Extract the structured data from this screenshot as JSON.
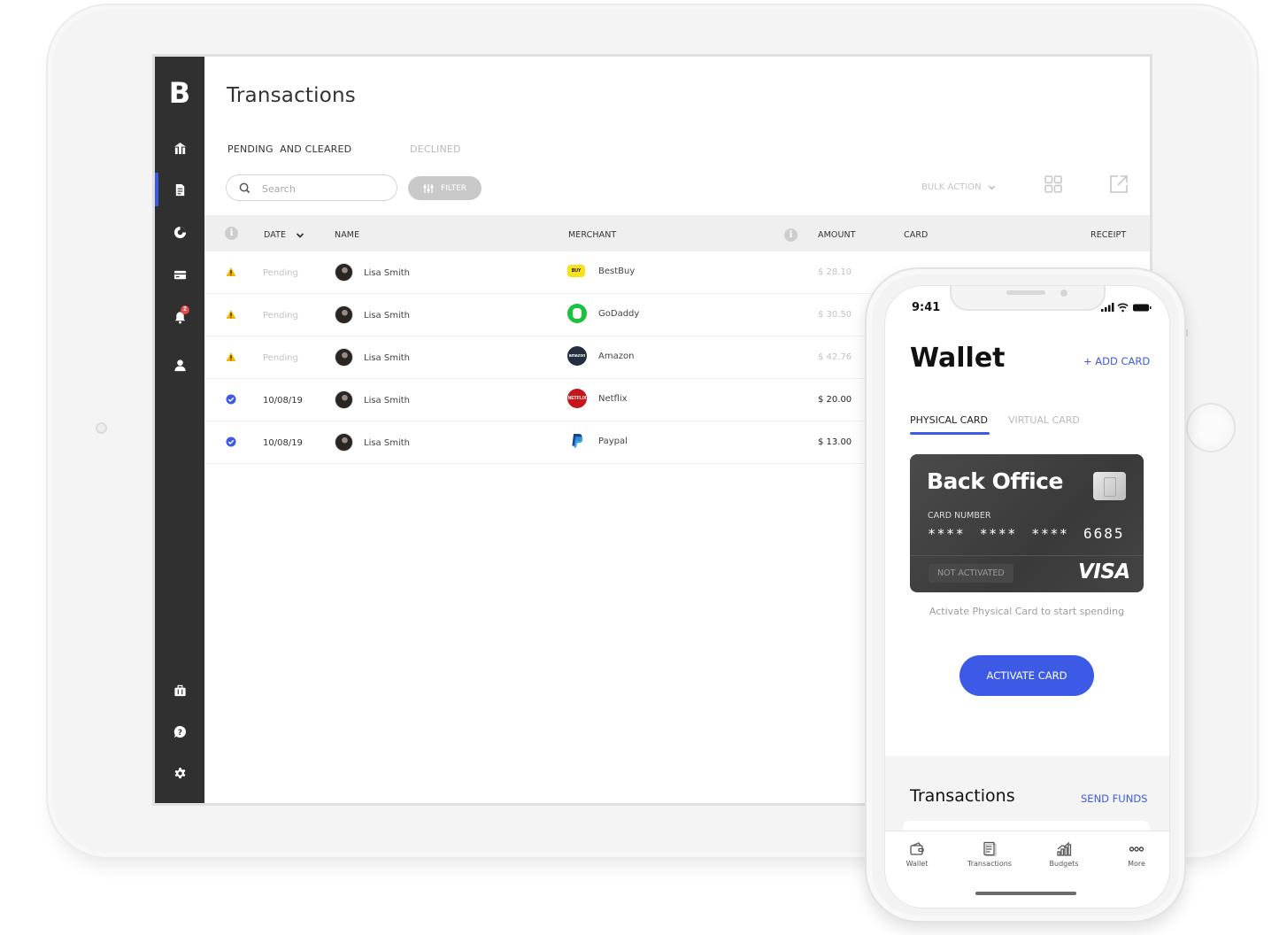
{
  "tablet": {
    "app": {
      "logo": "B",
      "title": "Transactions",
      "tabs": [
        {
          "label": "PENDING  AND CLEARED",
          "active": true
        },
        {
          "label": "DECLINED",
          "active": false
        }
      ],
      "search": {
        "placeholder": "Search",
        "value": ""
      },
      "filter_label": "FILTER",
      "bulk_action_label": "BULK ACTION",
      "sidebar": {
        "items": [
          {
            "icon": "bank-icon",
            "label": "Dashboard",
            "active": false
          },
          {
            "icon": "document-icon",
            "label": "Transactions",
            "active": true
          },
          {
            "icon": "pie-chart-icon",
            "label": "Reports",
            "active": false
          },
          {
            "icon": "credit-card-icon",
            "label": "Cards",
            "active": false
          },
          {
            "icon": "bell-icon",
            "label": "Notifications",
            "active": false,
            "badge": "2"
          },
          {
            "icon": "user-icon",
            "label": "Profile",
            "active": false
          }
        ],
        "bottom_items": [
          {
            "icon": "briefcase-icon",
            "label": "Business"
          },
          {
            "icon": "help-icon",
            "label": "Help"
          },
          {
            "icon": "gear-icon",
            "label": "Settings"
          }
        ]
      },
      "table": {
        "columns": {
          "date": "DATE",
          "name": "NAME",
          "merchant": "MERCHANT",
          "amount": "AMOUNT",
          "card": "CARD",
          "receipt": "RECEIPT"
        },
        "rows": [
          {
            "status": "pending",
            "date": "Pending",
            "name": "Lisa Smith",
            "merchant": "BestBuy",
            "merchant_logo_color": "#f7e11a",
            "amount": "$ 28.10"
          },
          {
            "status": "pending",
            "date": "Pending",
            "name": "Lisa Smith",
            "merchant": "GoDaddy",
            "merchant_logo_color": "#1bc23e",
            "amount": "$ 30.50"
          },
          {
            "status": "pending",
            "date": "Pending",
            "name": "Lisa Smith",
            "merchant": "Amazon",
            "merchant_logo_color": "#232f3e",
            "amount": "$ 42.76"
          },
          {
            "status": "cleared",
            "date": "10/08/19",
            "name": "Lisa Smith",
            "merchant": "Netflix",
            "merchant_logo_color": "#c4161c",
            "amount": "$ 20.00"
          },
          {
            "status": "cleared",
            "date": "10/08/19",
            "name": "Lisa Smith",
            "merchant": "Paypal",
            "merchant_logo_color": "#ffffff",
            "amount": "$ 13.00"
          }
        ]
      }
    }
  },
  "phone": {
    "status_bar": {
      "time": "9:41"
    },
    "title": "Wallet",
    "add_card_label": "+ ADD CARD",
    "tabs": [
      {
        "label": "PHYSICAL CARD",
        "active": true
      },
      {
        "label": "VIRTUAL CARD",
        "active": false
      }
    ],
    "card": {
      "name": "Back Office",
      "number_label": "CARD NUMBER",
      "masked": "**** **** ****",
      "last4": "6685",
      "status": "NOT ACTIVATED",
      "network": "VISA"
    },
    "hint": "Activate Physical Card to start spending",
    "activate_label": "ACTIVATE CARD",
    "transactions_title": "Transactions",
    "send_funds_label": "SEND FUNDS",
    "tabbar": [
      {
        "icon": "wallet-icon",
        "label": "Wallet"
      },
      {
        "icon": "receipt-icon",
        "label": "Transactions"
      },
      {
        "icon": "chart-icon",
        "label": "Budgets"
      },
      {
        "icon": "more-icon",
        "label": "More"
      }
    ]
  },
  "colors": {
    "accent": "#3d5ae6",
    "sidebar": "#303030",
    "warning": "#f5b800",
    "badge": "#e8464b"
  }
}
